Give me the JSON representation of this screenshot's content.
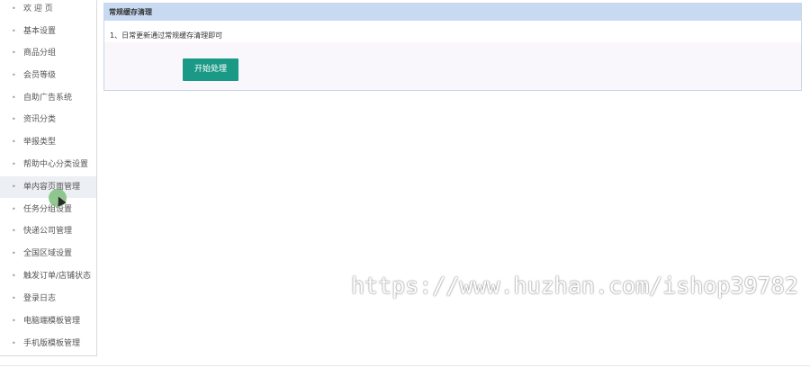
{
  "sidebar": {
    "bullet": "•",
    "items": [
      {
        "label": "欢 迎 页"
      },
      {
        "label": "基本设置"
      },
      {
        "label": "商品分组"
      },
      {
        "label": "会员等级"
      },
      {
        "label": "自助广告系统"
      },
      {
        "label": "资讯分类"
      },
      {
        "label": "举报类型"
      },
      {
        "label": "帮助中心分类设置"
      },
      {
        "label": "单内容页面管理"
      },
      {
        "label": "任务分组设置"
      },
      {
        "label": "快递公司管理"
      },
      {
        "label": "全国区域设置"
      },
      {
        "label": "触发订单/店铺状态"
      },
      {
        "label": "登录日志"
      },
      {
        "label": "电脑端模板管理"
      },
      {
        "label": "手机版模板管理"
      }
    ]
  },
  "panel": {
    "title": "常规缓存清理",
    "note": "1、日常更新通过常规缓存清理即可",
    "start_button": "开始处理"
  },
  "watermark": "https://www.huzhan.com/ishop39782",
  "colors": {
    "accent": "#1a9a86",
    "panel_header": "#c8daf1"
  }
}
